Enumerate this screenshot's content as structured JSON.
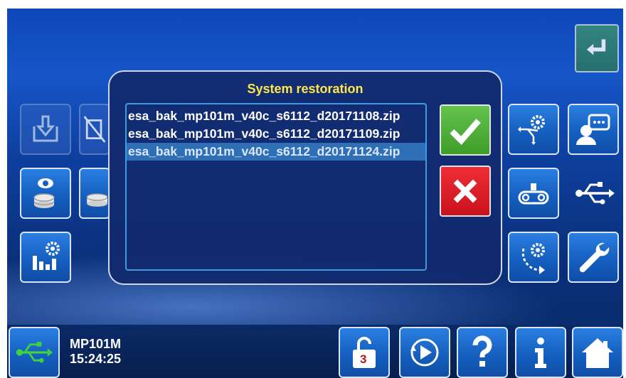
{
  "dialog": {
    "title": "System restoration",
    "files": [
      "esa_bak_mp101m_v40c_s6112_d20171108.zip",
      "esa_bak_mp101m_v40c_s6112_d20171109.zip",
      "esa_bak_mp101m_v40c_s6112_d20171124.zip"
    ],
    "selected_index": 2,
    "confirm_icon": "check-icon",
    "cancel_icon": "x-icon"
  },
  "status": {
    "device_name": "MP101M",
    "time": "15:24:25"
  },
  "bottom_bar": {
    "lock_level": "3"
  },
  "colors": {
    "dialog_title": "#ffe74a",
    "confirm": "#4caf3a",
    "cancel": "#d9161f",
    "selected_row": "#2e6fb6"
  }
}
